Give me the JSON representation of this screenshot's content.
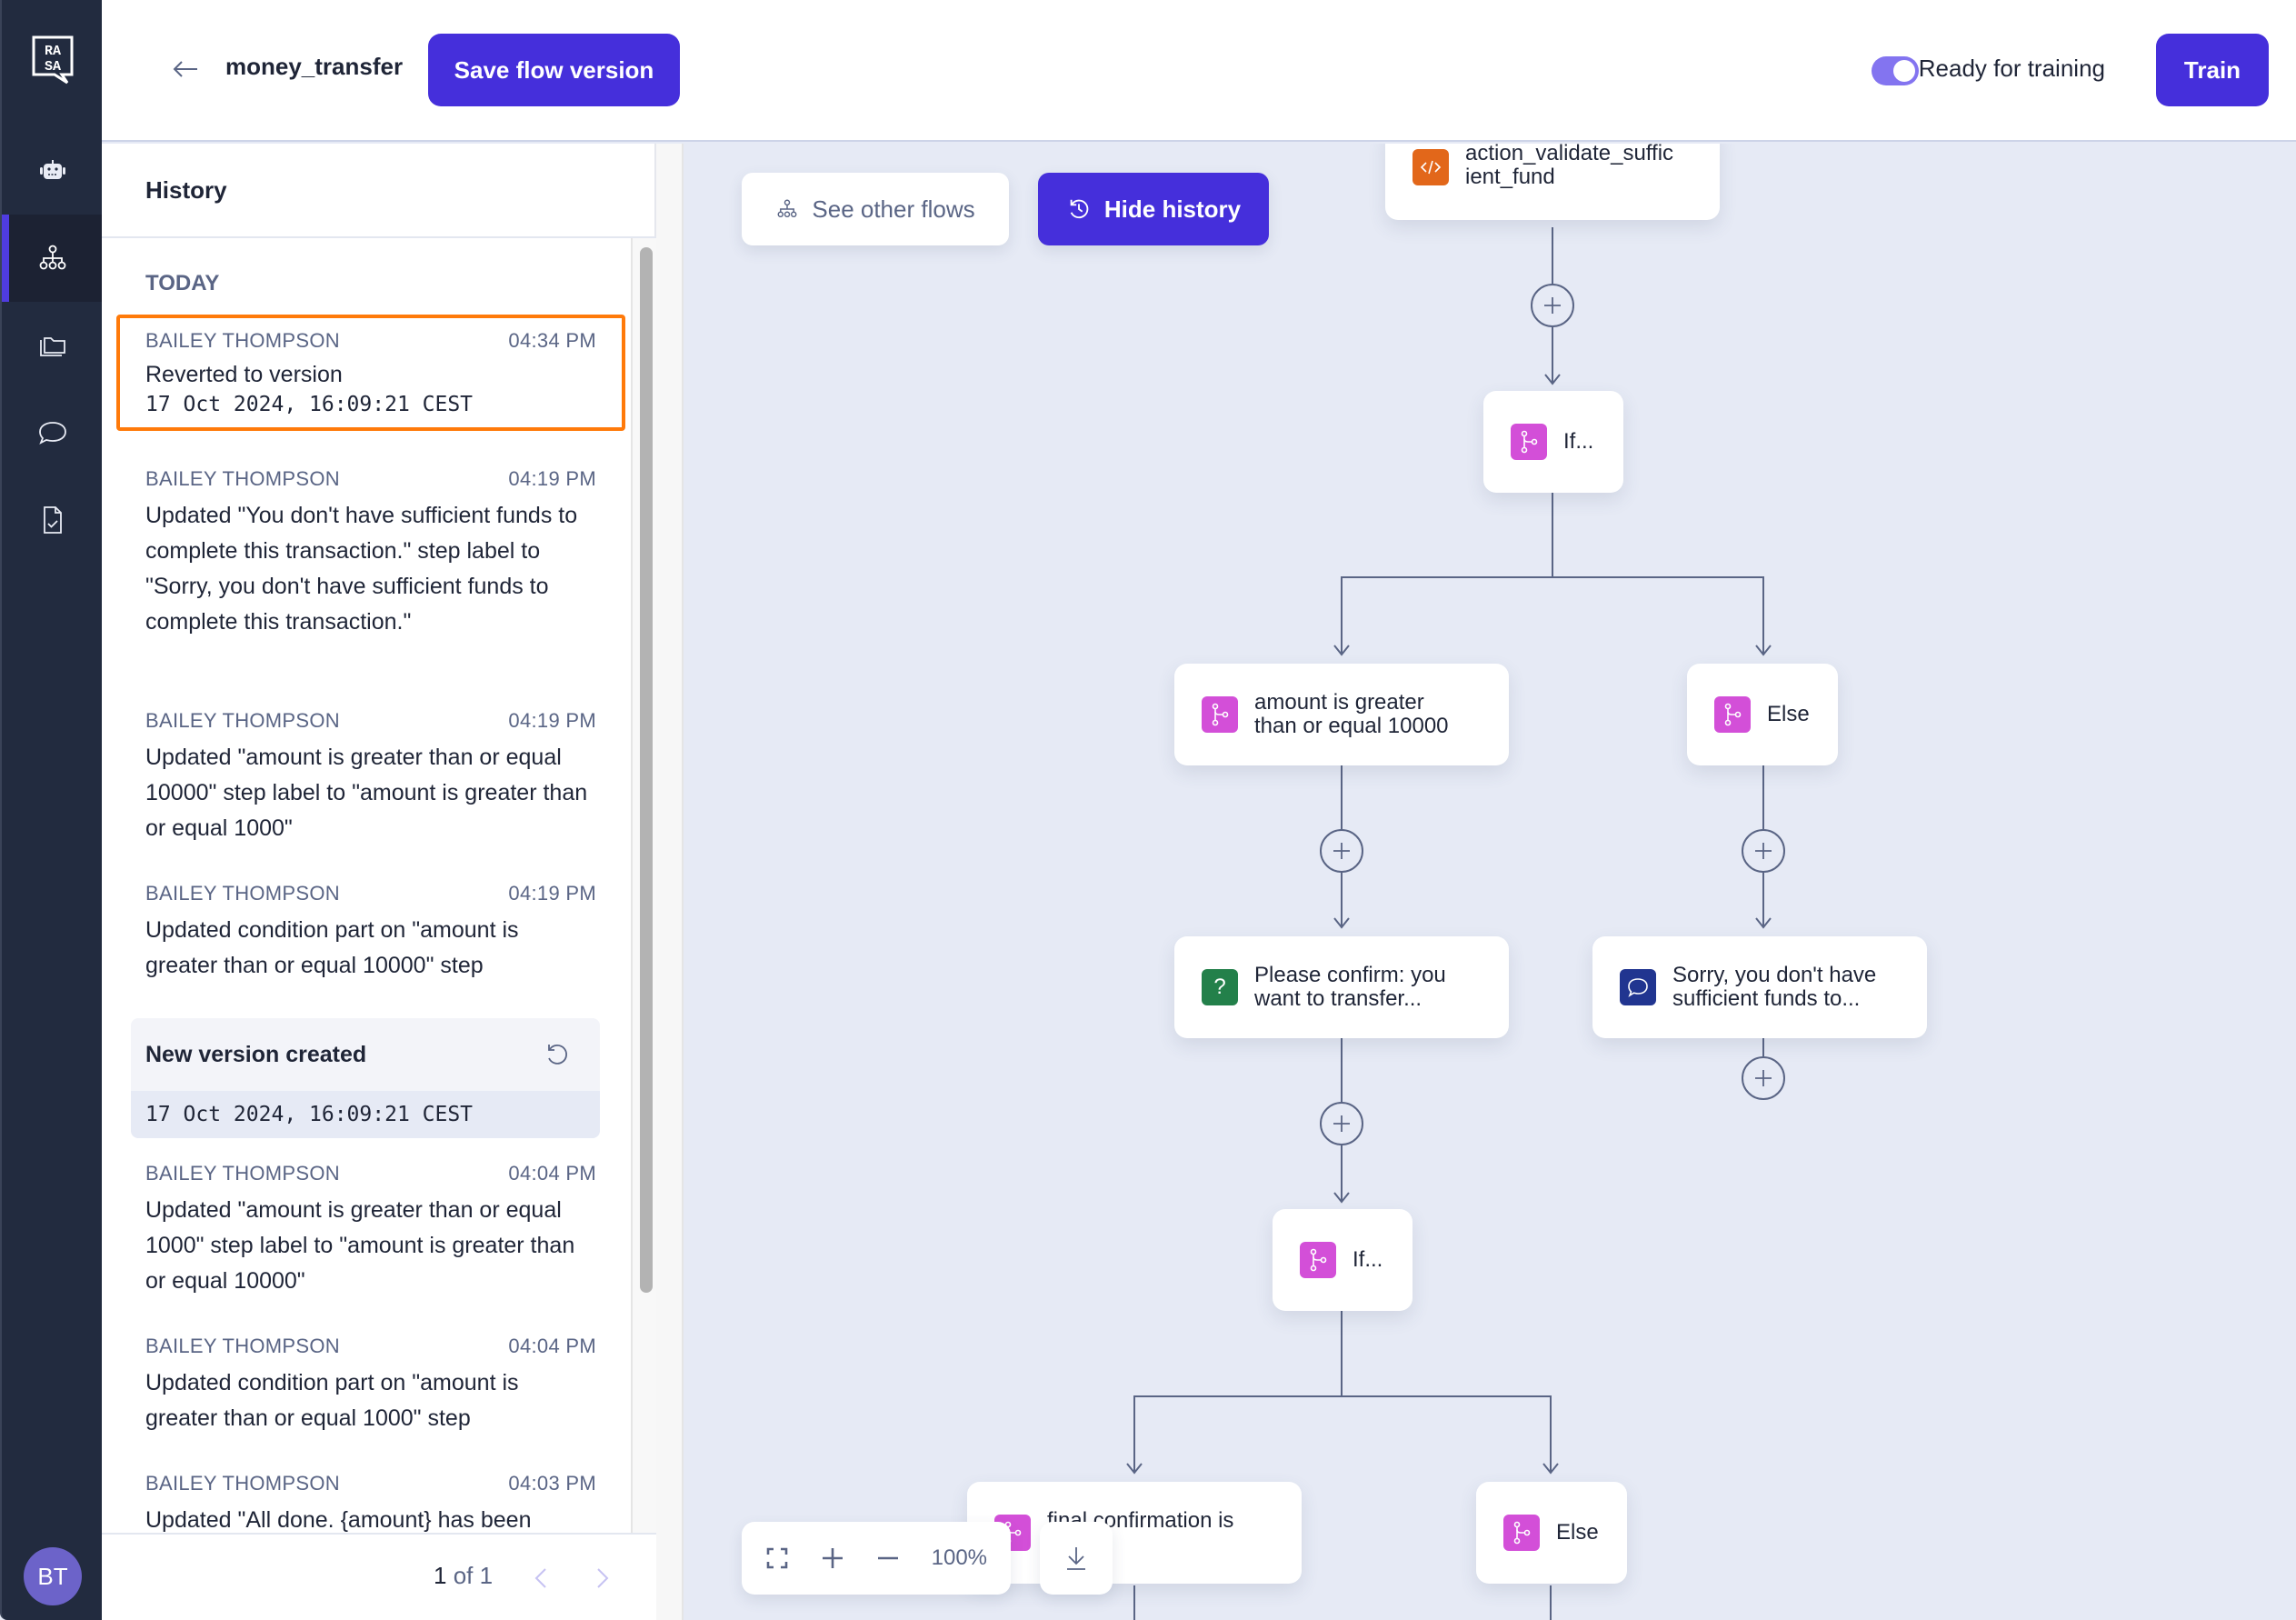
{
  "app": {
    "logo_text": "RASA",
    "nav": [
      {
        "name": "assistant",
        "icon": "robot-icon",
        "active": false
      },
      {
        "name": "flows",
        "icon": "flow-tree-icon",
        "active": true
      },
      {
        "name": "content",
        "icon": "folder-icon",
        "active": false
      },
      {
        "name": "conversations",
        "icon": "chat-bubble-icon",
        "active": false
      },
      {
        "name": "tests",
        "icon": "file-check-icon",
        "active": false
      }
    ],
    "user_initials": "BT"
  },
  "header": {
    "flow_name": "money_transfer",
    "save_label": "Save flow version",
    "toggle_label": "Ready for training",
    "toggle_on": true,
    "train_label": "Train"
  },
  "history": {
    "title": "History",
    "section": "TODAY",
    "entries": [
      {
        "author": "BAILEY THOMPSON",
        "time": "04:34 PM",
        "text": "Reverted to version",
        "mono": "17 Oct 2024, 16:09:21 CEST",
        "highlighted": true
      },
      {
        "author": "BAILEY THOMPSON",
        "time": "04:19 PM",
        "text": "Updated \"You don't have sufficient funds to complete this transaction.\" step label to \"Sorry, you don't have sufficient funds to complete this transaction.\""
      },
      {
        "author": "BAILEY THOMPSON",
        "time": "04:19 PM",
        "text": "Updated \"amount is greater than or equal 10000\" step label to \"amount is greater than or equal 1000\""
      },
      {
        "author": "BAILEY THOMPSON",
        "time": "04:19 PM",
        "text": "Updated condition part on \"amount is greater than or equal 10000\" step"
      },
      {
        "author": "BAILEY THOMPSON",
        "time": "04:04 PM",
        "text": "Updated \"amount is greater than or equal 1000\" step label to \"amount is greater than or equal 10000\""
      },
      {
        "author": "BAILEY THOMPSON",
        "time": "04:04 PM",
        "text": "Updated condition part on \"amount is greater than or equal 1000\" step"
      },
      {
        "author": "BAILEY THOMPSON",
        "time": "04:03 PM",
        "text": "Updated \"All done. {amount} has been"
      }
    ],
    "version_card": {
      "title": "New version created",
      "date": "17 Oct 2024, 16:09:21 CEST"
    },
    "pagination": {
      "current": "1",
      "of_label": "of",
      "total": "1"
    }
  },
  "canvas": {
    "see_flows_label": "See other flows",
    "hide_history_label": "Hide history",
    "nodes": [
      {
        "id": "action",
        "type": "action",
        "label": "action_validate_suffic\nient_fund"
      },
      {
        "id": "if1",
        "type": "branch",
        "label": "If..."
      },
      {
        "id": "cond1",
        "type": "branch",
        "label": "amount is greater\nthan or equal 10000"
      },
      {
        "id": "else1",
        "type": "branch",
        "label": "Else"
      },
      {
        "id": "confirm",
        "type": "question",
        "label": "Please confirm: you\nwant to transfer..."
      },
      {
        "id": "sorry",
        "type": "message",
        "label": "Sorry, you don't have\nsufficient funds to..."
      },
      {
        "id": "if2",
        "type": "branch",
        "label": "If..."
      },
      {
        "id": "cond2",
        "type": "branch",
        "label": "final confirmation is"
      },
      {
        "id": "else2",
        "type": "branch",
        "label": "Else"
      }
    ],
    "zoom_level": "100%"
  }
}
